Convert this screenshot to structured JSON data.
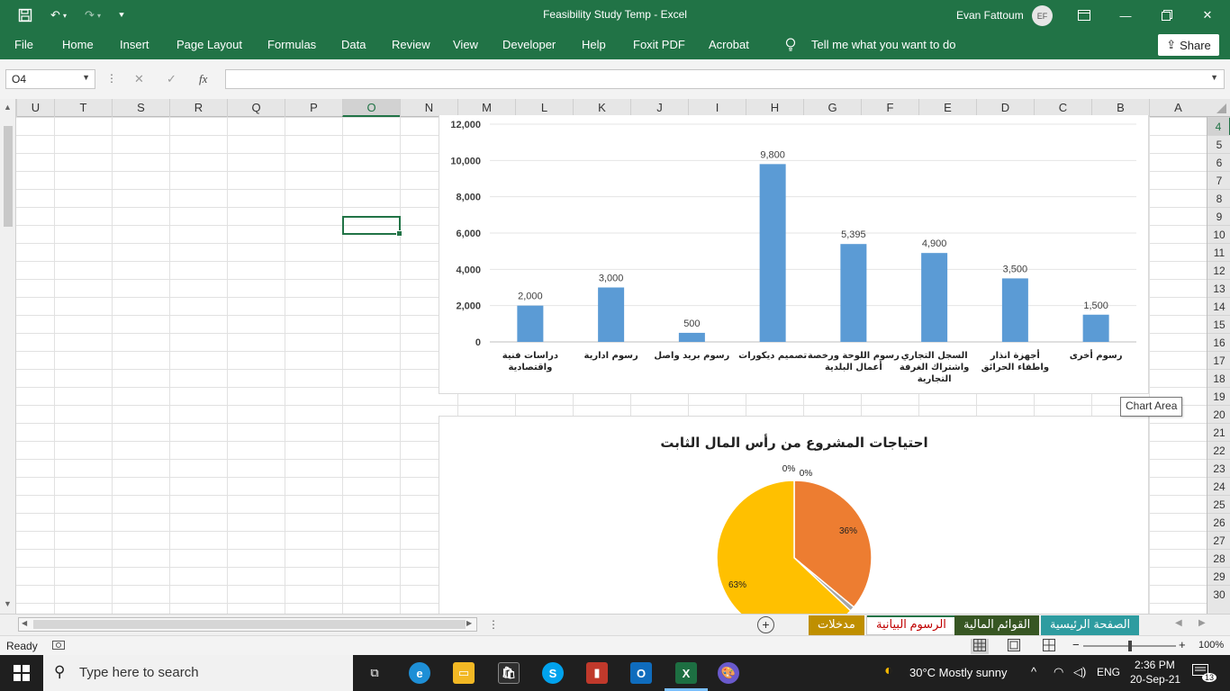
{
  "window": {
    "title": "Feasibility Study Temp  -  Excel",
    "user_name": "Evan Fattoum",
    "user_initials": "EF"
  },
  "ribbon": {
    "tabs": [
      "File",
      "Home",
      "Insert",
      "Page Layout",
      "Formulas",
      "Data",
      "Review",
      "View",
      "Developer",
      "Help",
      "Foxit PDF",
      "Acrobat"
    ],
    "tell_me": "Tell me what you want to do",
    "share": "Share"
  },
  "formula_bar": {
    "name_box": "O4",
    "formula": ""
  },
  "grid": {
    "columns": [
      "U",
      "T",
      "S",
      "R",
      "Q",
      "P",
      "O",
      "N",
      "M",
      "L",
      "K",
      "J",
      "I",
      "H",
      "G",
      "F",
      "E",
      "D",
      "C",
      "B",
      "A"
    ],
    "selected_column": "O",
    "rows": [
      "4",
      "5",
      "6",
      "7",
      "8",
      "9",
      "10",
      "11",
      "12",
      "13",
      "14",
      "15",
      "16",
      "17",
      "18",
      "19",
      "20",
      "21",
      "22",
      "23",
      "24",
      "25",
      "26",
      "27",
      "28",
      "29",
      "30"
    ],
    "selected_row": "4"
  },
  "chart_data": [
    {
      "type": "bar",
      "title": "",
      "categories": [
        "دراسات فنية واقتصادية",
        "رسوم ادارية",
        "رسوم بريد واصل",
        "تصميم ديكورات",
        "رسوم اللوحة ورخصة أعمال البلدية",
        "السجل التجاري واشتراك الغرفة التجارية",
        "أجهزة انذار واطفاء الحرائق",
        "رسوم أخرى"
      ],
      "values": [
        2000,
        3000,
        500,
        9800,
        5395,
        4900,
        3500,
        1500
      ],
      "value_labels": [
        "2,000",
        "3,000",
        "500",
        "9,800",
        "5,395",
        "4,900",
        "3,500",
        "1,500"
      ],
      "y_ticks": [
        "0",
        "2,000",
        "4,000",
        "6,000",
        "8,000",
        "10,000",
        "12,000"
      ],
      "ylim": [
        0,
        12000
      ],
      "grid": true,
      "color": "#5b9bd5"
    },
    {
      "type": "pie",
      "title": "احتياجات المشروع من رأس المال الثابت",
      "values": [
        36,
        1,
        63,
        0,
        0
      ],
      "labels": [
        "36%",
        "",
        "63%",
        "0%",
        "0%"
      ],
      "colors": [
        "#ed7d31",
        "#a5a5a5",
        "#ffc000",
        "#4472c4",
        "#5b9bd5"
      ]
    }
  ],
  "tooltip": "Chart Area",
  "sheet_tabs": [
    {
      "label": "مدخلات",
      "bg": "#bf8f00",
      "fg": "#ffffff"
    },
    {
      "label": "الرسوم البيانية",
      "bg": "#ffffff",
      "fg": "#c00000"
    },
    {
      "label": "القوائم المالية",
      "bg": "#375623",
      "fg": "#ffffff"
    },
    {
      "label": "الصفحة الرئيسية",
      "bg": "#2e9ca0",
      "fg": "#ffffff"
    }
  ],
  "status": {
    "ready": "Ready",
    "zoom": "100%",
    "zoom_fraction": 0.5
  },
  "taskbar": {
    "search_placeholder": "Type here to search",
    "weather": "30°C  Mostly sunny",
    "language": "ENG",
    "time": "2:36 PM",
    "date": "20-Sep-21",
    "notifications": "13"
  }
}
